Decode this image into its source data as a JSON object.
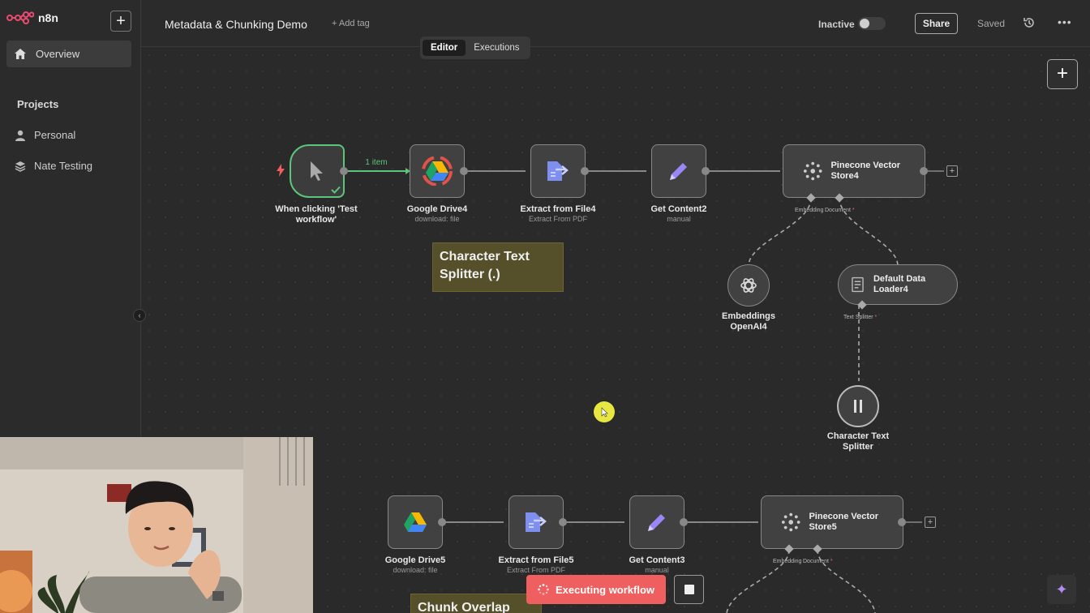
{
  "app": {
    "logo_text": "n8n",
    "brand_color": "#ea4b71",
    "workflow_title": "Metadata & Chunking Demo",
    "add_tag": "+ Add tag"
  },
  "sidebar": {
    "overview": "Overview",
    "projects_title": "Projects",
    "items": [
      {
        "label": "Personal",
        "icon": "user-icon"
      },
      {
        "label": "Nate Testing",
        "icon": "layers-icon"
      }
    ]
  },
  "topbar": {
    "status_label": "Inactive",
    "share_label": "Share",
    "saved_label": "Saved"
  },
  "tabs": [
    "Editor",
    "Executions"
  ],
  "workflow": {
    "top_row": {
      "trigger": {
        "title": "When clicking 'Test workflow'"
      },
      "edge_label": "1 item",
      "drive": {
        "title": "Google Drive4",
        "subtitle": "download: file"
      },
      "extract": {
        "title": "Extract from File4",
        "subtitle": "Extract From PDF"
      },
      "set": {
        "title": "Get Content2",
        "subtitle": "manual"
      },
      "vector": {
        "title": "Pinecone Vector Store4"
      },
      "ports": {
        "embedding": "Embedding",
        "document": "Document"
      },
      "embeddings": {
        "title": "Embeddings OpenAI4"
      },
      "loader": {
        "title": "Default Data Loader4",
        "port": "Text Splitter"
      },
      "splitter": {
        "title": "Character Text Splitter"
      }
    },
    "bottom_row": {
      "drive": {
        "title": "Google Drive5",
        "subtitle": "download: file"
      },
      "extract": {
        "title": "Extract from File5",
        "subtitle": "Extract From PDF"
      },
      "set": {
        "title": "Get Content3",
        "subtitle": "manual"
      },
      "vector": {
        "title": "Pinecone Vector Store5"
      },
      "ports": {
        "embedding": "Embedding",
        "document": "Document"
      }
    },
    "required_mark": "*"
  },
  "stickies": {
    "splitter_note": "Character Text Splitter (.)",
    "overlap_note": "Chunk Overlap"
  },
  "footer": {
    "executing_label": "Executing workflow"
  },
  "colors": {
    "success_green": "#5bc57a",
    "execute_red": "#ef5f5f",
    "sticky_yellow": "#55502a",
    "cursor_yellow": "#e8e640"
  }
}
